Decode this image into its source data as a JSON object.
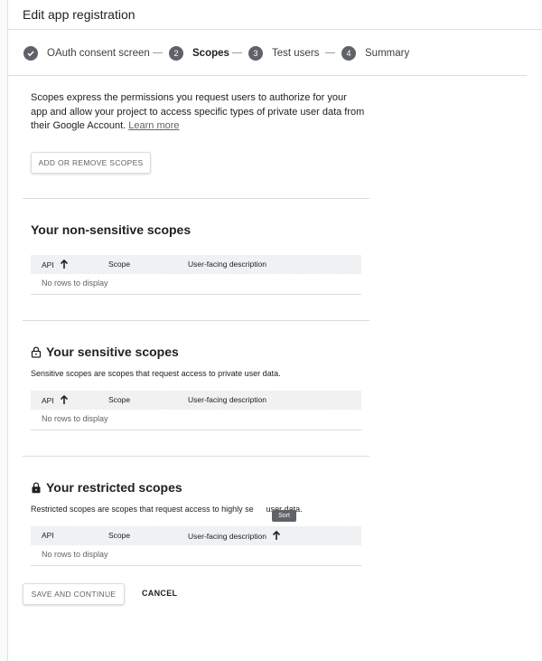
{
  "header": {
    "title": "Edit app registration"
  },
  "stepper": {
    "steps": [
      {
        "number": "",
        "label": "OAuth consent screen",
        "state": "completed"
      },
      {
        "number": "2",
        "label": "Scopes",
        "state": "active"
      },
      {
        "number": "3",
        "label": "Test users",
        "state": "upcoming"
      },
      {
        "number": "4",
        "label": "Summary",
        "state": "upcoming"
      }
    ]
  },
  "intro": {
    "text": "Scopes express the permissions you request users to authorize for your app and allow your project to access specific types of private user data from their Google Account.",
    "link": "Learn more"
  },
  "add_scopes_label": "ADD OR REMOVE SCOPES",
  "table_headers": {
    "api": "API",
    "scope": "Scope",
    "description": "User-facing description"
  },
  "sections": {
    "non_sensitive": {
      "title": "Your non-sensitive scopes",
      "empty": "No rows to display"
    },
    "sensitive": {
      "title": "Your sensitive scopes",
      "description": "Sensitive scopes are scopes that request access to private user data.",
      "empty": "No rows to display"
    },
    "restricted": {
      "title": "Your restricted scopes",
      "description": "Restricted scopes are scopes that request access to highly se",
      "description_tail": "user data.",
      "empty": "No rows to display"
    }
  },
  "tooltip": {
    "text": "Sort"
  },
  "actions": {
    "save": "SAVE AND CONTINUE",
    "cancel": "CANCEL"
  },
  "icons": {
    "completed_step": "check-circle-icon",
    "sort": "arrow-up-icon",
    "sensitive_lock": "lock-open-outline-icon",
    "restricted_lock": "lock-filled-icon"
  }
}
